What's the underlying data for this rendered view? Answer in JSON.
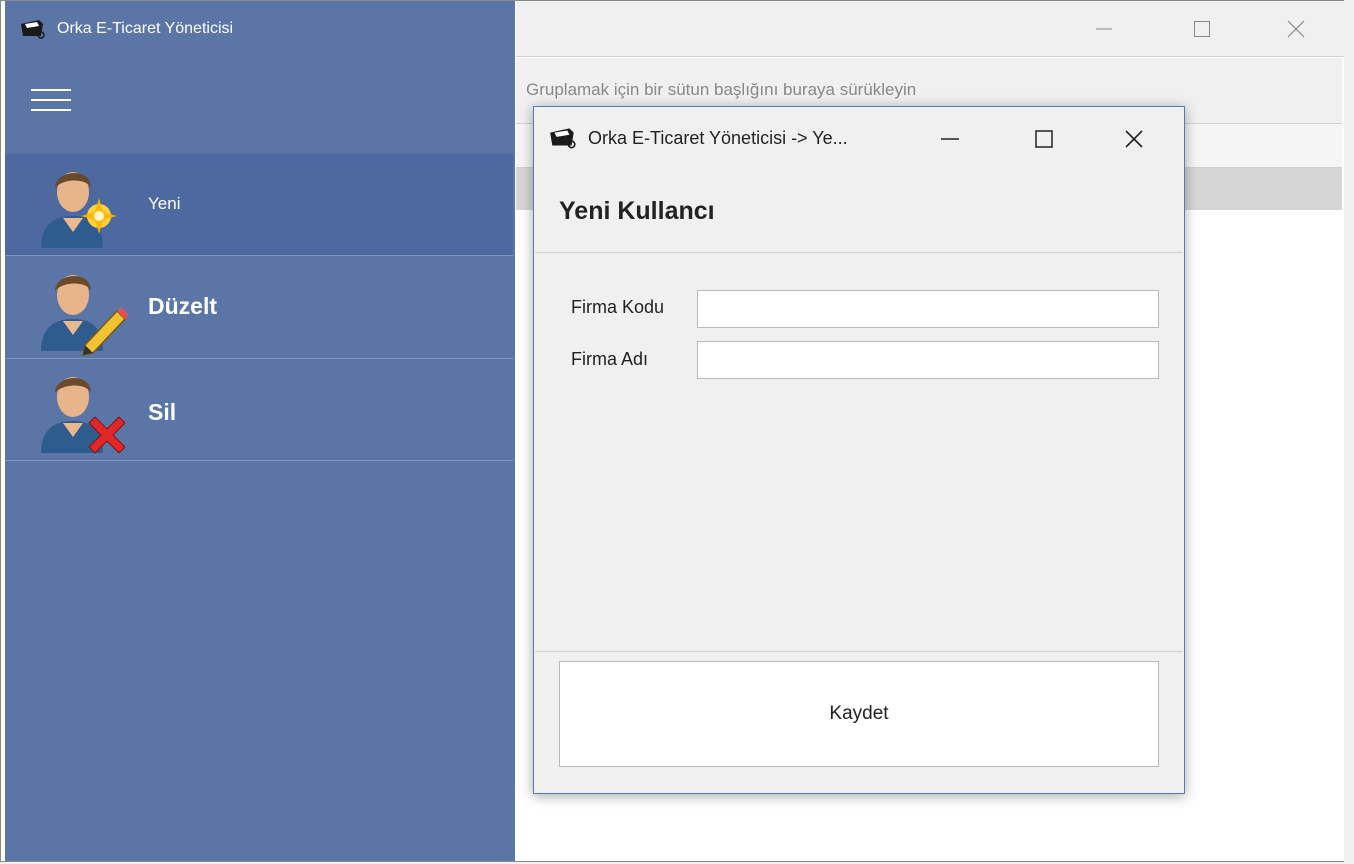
{
  "app": {
    "title": "Orka E-Ticaret Yöneticisi",
    "icon": "robot-icon"
  },
  "sidebar": {
    "menu_icon": "hamburger-icon",
    "items": [
      {
        "label": "Yeni",
        "icon": "user-new-icon",
        "active": true
      },
      {
        "label": "Düzelt",
        "icon": "user-edit-icon",
        "active": false
      },
      {
        "label": "Sil",
        "icon": "user-delete-icon",
        "active": false
      }
    ],
    "colors": {
      "background": "#5b76a6",
      "active": "#4d69a0"
    }
  },
  "main": {
    "group_panel_text": "Gruplamak için bir sütun başlığını buraya sürükleyin"
  },
  "dialog": {
    "title": "Orka E-Ticaret Yöneticisi -> Ye...",
    "heading": "Yeni Kullancı",
    "fields": [
      {
        "label": "Firma Kodu",
        "value": ""
      },
      {
        "label": "Firma Adı",
        "value": ""
      }
    ],
    "save_label": "Kaydet"
  }
}
